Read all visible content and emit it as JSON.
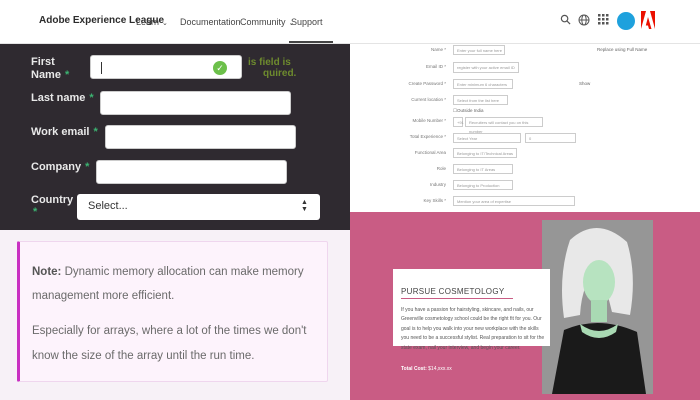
{
  "nav": {
    "brand": "Adobe Experience League",
    "learn": "Learn",
    "documentation": "Documentation",
    "community": "Community",
    "support": "Support",
    "caret": "⌄"
  },
  "form": {
    "first_name_line1": "First",
    "first_name_line2": "Name",
    "required_mark": "*",
    "faded_msg_line1": "is field is",
    "faded_msg_line2": "quired.",
    "last_name": "Last name",
    "work_email": "Work email",
    "company": "Company",
    "country": "Country",
    "country_select": "Select..."
  },
  "note": {
    "label": "Note:",
    "text1": " Dynamic memory allocation can make memory management more efficient.",
    "text2": "Especially for arrays, where a lot of the times we don't know the size of the array until the run time."
  },
  "rform": {
    "name_label": "Name *",
    "name_placeholder": "Enter your full name here",
    "name_hint": "Replace using Full Name",
    "email_label": "Email ID *",
    "email_placeholder": "register with your active email ID",
    "password_label": "Create Password *",
    "password_placeholder": "Enter minimum 6 characters",
    "show": "Show",
    "location_label": "Current location *",
    "location_placeholder": "Select from the list here",
    "outside_india": "Outside India",
    "mobile_label": "Mobile Number *",
    "mobile_prefix": "+91",
    "mobile_placeholder": "Recruiters will contact you on this number",
    "experience_label": "Total Experience *",
    "experience_year": "Select Year",
    "experience_month": "0",
    "functional_label": "Functional Area",
    "functional_placeholder": "Belonging to IT/Technical Areas",
    "role_label": "Role",
    "role_placeholder": "Belonging to IT Areas",
    "industry_label": "Industry",
    "industry_placeholder": "Belonging to Production",
    "keyskills_label": "Key Skills *",
    "keyskills_placeholder": "Mention your area of expertise"
  },
  "cosmetology": {
    "title": "PURSUE COSMETOLOGY",
    "body": "If you have a passion for hairstyling, skincare, and nails, our Greenville cosmetology school could be the right fit for you. Our goal is to help you walk into your new workplace with the skills you need to be a successful stylist. Real preparation to sit for the state exam, nail your interview, and begin your career.",
    "overflow": "Total Cost: $14,xxx.xx",
    "total_label": "Total Cost:",
    "total_value": "$14,xxx.xx"
  },
  "colors": {
    "dark_form_bg": "#2f2a30",
    "accent_green": "#3cb371",
    "note_accent": "#c930c2",
    "pink_bg": "#c95c84",
    "adobe_red": "#eb1000",
    "avatar_blue": "#1ea1dd"
  },
  "icons": [
    "search-icon",
    "globe-icon",
    "apps-grid-icon",
    "avatar-icon",
    "adobe-logo-icon",
    "check-icon",
    "select-arrows-icon"
  ]
}
